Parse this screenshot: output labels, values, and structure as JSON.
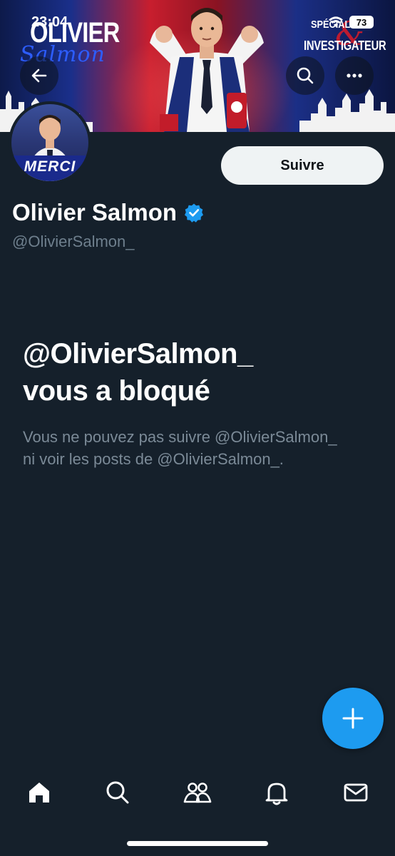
{
  "status_bar": {
    "time": "23:04",
    "battery": "73"
  },
  "banner": {
    "title_left": "OLIVIER",
    "script_left": "Salmon",
    "title_right_1": "SPÉCIALISTE",
    "title_right_2": "INVESTIGATEUR"
  },
  "profile": {
    "avatar_caption": "MERCI",
    "follow_label": "Suivre",
    "display_name": "Olivier Salmon",
    "handle": "@OlivierSalmon_"
  },
  "blocked": {
    "title_line1": "@OlivierSalmon_",
    "title_line2": "vous a bloqué",
    "message": "Vous ne pouvez pas suivre @OlivierSalmon_ ni voir les posts de @OlivierSalmon_."
  },
  "colors": {
    "background": "#15202b",
    "accent": "#1d9bf0",
    "muted_text": "#6e7f8d",
    "follow_button_bg": "#eff3f4"
  },
  "icons": {
    "back": "arrow-left-icon",
    "search": "search-icon",
    "more": "more-horizontal-icon",
    "verified": "verified-badge-icon",
    "fab": "plus-icon",
    "nav": [
      "home-icon",
      "search-icon",
      "communities-icon",
      "bell-icon",
      "mail-icon"
    ]
  }
}
